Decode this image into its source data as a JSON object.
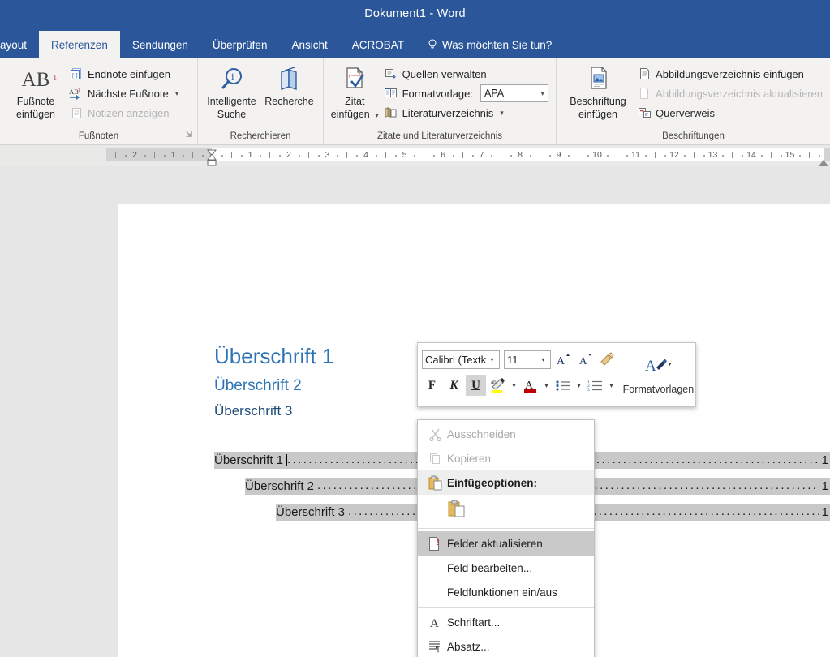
{
  "window": {
    "title": "Dokument1  -  Word",
    "accent": "#2b579a"
  },
  "ribbon": {
    "tabs": [
      {
        "label": "ayout",
        "active": false,
        "clipped": true
      },
      {
        "label": "Referenzen",
        "active": true
      },
      {
        "label": "Sendungen",
        "active": false
      },
      {
        "label": "Überprüfen",
        "active": false
      },
      {
        "label": "Ansicht",
        "active": false
      },
      {
        "label": "ACROBAT",
        "active": false
      }
    ],
    "tell_me": "Was möchten Sie tun?",
    "groups": [
      {
        "title": "Fußnoten",
        "big": {
          "line1": "Fußnote",
          "line2": "einfügen",
          "icon": "AB",
          "sup": "1"
        },
        "items": [
          {
            "label": "Endnote einfügen",
            "icon": "endnote-icon",
            "disabled": false,
            "caret": false
          },
          {
            "label": "Nächste Fußnote",
            "icon": "next-footnote-icon",
            "disabled": false,
            "caret": true
          },
          {
            "label": "Notizen anzeigen",
            "icon": "show-notes-icon",
            "disabled": true,
            "caret": false
          }
        ],
        "launcher": true
      },
      {
        "title": "Recherchieren",
        "buttons": [
          {
            "line1": "Intelligente",
            "line2": "Suche",
            "icon": "smart-lookup-icon"
          },
          {
            "line1": "Recherche",
            "line2": "",
            "icon": "researcher-icon"
          }
        ]
      },
      {
        "title": "Zitate und Literaturverzeichnis",
        "big": {
          "line1": "Zitat",
          "line2": "einfügen",
          "icon": "insert-citation-icon",
          "caret": true
        },
        "items": [
          {
            "label": "Quellen verwalten",
            "icon": "manage-sources-icon",
            "disabled": false,
            "caret": false
          },
          {
            "label": "Formatvorlage:",
            "icon": "style-icon",
            "disabled": false,
            "combo": "APA"
          },
          {
            "label": "Literaturverzeichnis",
            "icon": "bibliography-icon",
            "disabled": false,
            "caret": true
          }
        ]
      },
      {
        "title": "Beschriftungen",
        "big": {
          "line1": "Beschriftung",
          "line2": "einfügen",
          "icon": "insert-caption-icon"
        },
        "items": [
          {
            "label": "Abbildungsverzeichnis einfügen",
            "icon": "insert-table-of-figures-icon",
            "disabled": false,
            "caret": false
          },
          {
            "label": "Abbildungsverzeichnis aktualisieren",
            "icon": "update-table-of-figures-icon",
            "disabled": true,
            "caret": false
          },
          {
            "label": "Querverweis",
            "icon": "cross-reference-icon",
            "disabled": false,
            "caret": false
          }
        ]
      }
    ]
  },
  "ruler": {
    "left_ticks": [
      "2",
      "1"
    ],
    "right_ticks": [
      "1",
      "2",
      "3",
      "4",
      "5",
      "6",
      "7",
      "8",
      "9",
      "10",
      "11",
      "12",
      "13",
      "14",
      "15"
    ]
  },
  "document": {
    "headings": [
      {
        "text": "Überschrift 1",
        "level": 1
      },
      {
        "text": "Überschrift 2",
        "level": 2
      },
      {
        "text": "Überschrift 3",
        "level": 3
      }
    ],
    "toc": [
      {
        "text": "Überschrift 1",
        "page": "1",
        "indent": 0,
        "cursor": true
      },
      {
        "text": "Überschrift 2",
        "page": "1",
        "indent": 38,
        "cursor": false
      },
      {
        "text": "Überschrift 3",
        "page": "1",
        "indent": 76,
        "cursor": false
      }
    ]
  },
  "mini_toolbar": {
    "font_name": "Calibri (Textk",
    "font_size": "11",
    "buttons": {
      "grow_font": "A",
      "shrink_font": "A",
      "format_painter": "format-painter-icon",
      "bold": "F",
      "italic": "K",
      "underline": "U",
      "highlight": "ab",
      "font_color": "A",
      "bullets": "bullets-icon",
      "numbering": "numbering-icon"
    },
    "styles_label": "Formatvorlagen",
    "highlight_color": "#ffff00",
    "font_color": "#c00000"
  },
  "context_menu": {
    "items": [
      {
        "label": "Ausschneiden",
        "icon": "cut-icon",
        "disabled": true,
        "accel_index": 5
      },
      {
        "label": "Kopieren",
        "icon": "copy-icon",
        "disabled": true,
        "accel_index": 1
      },
      {
        "label": "Einfügeoptionen:",
        "icon": "paste-icon",
        "header": true
      },
      {
        "label": "",
        "icon": "paste-keep-formatting-icon",
        "paste_row": true
      },
      {
        "label": "Felder aktualisieren",
        "icon": "update-field-icon",
        "selected": true,
        "accel_index": 10
      },
      {
        "label": "Feld bearbeiten...",
        "icon": "",
        "accel_index": 0
      },
      {
        "label": "Feldfunktionen ein/aus",
        "icon": "",
        "accel_index": 0
      },
      {
        "label": "Schriftart...",
        "icon": "font-icon",
        "accel_index": 0
      },
      {
        "label": "Absatz...",
        "icon": "paragraph-icon",
        "accel_index": 1
      }
    ]
  }
}
